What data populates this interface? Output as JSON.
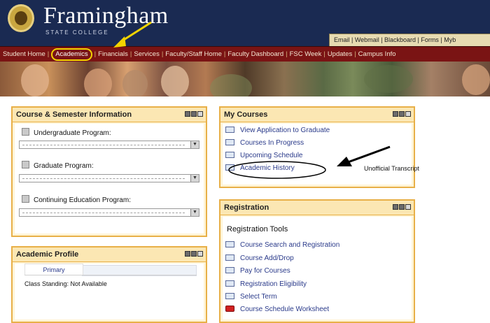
{
  "header": {
    "brand": "Framingham",
    "brand_sub": "STATE COLLEGE",
    "utility_links": "Email | Webmail | Blackboard | Forms | Myb"
  },
  "nav": {
    "items": [
      "Student Home",
      "Academics",
      "Financials",
      "Services",
      "Faculty/Staff Home",
      "Faculty Dashboard",
      "FSC Week",
      "Updates",
      "Campus Info"
    ]
  },
  "panels": {
    "course_semester": {
      "title": "Course & Semester Information",
      "programs": [
        "Undergraduate Program:",
        "Graduate Program:",
        "Continuing Education Program:"
      ]
    },
    "academic_profile": {
      "title": "Academic Profile",
      "tab": "Primary",
      "line": "Class Standing: Not Available"
    },
    "my_courses": {
      "title": "My Courses",
      "links": [
        "View Application to Graduate",
        "Courses In Progress",
        "Upcoming Schedule",
        "Academic History"
      ]
    },
    "registration": {
      "title": "Registration",
      "subtitle": "Registration Tools",
      "links": [
        "Course Search and Registration",
        "Course Add/Drop",
        "Pay for Courses",
        "Registration Eligibility",
        "Select Term",
        "Course Schedule Worksheet"
      ]
    }
  },
  "annotation": {
    "text": "Unofficial Transcript"
  },
  "colors": {
    "header_bg": "#1a2a52",
    "nav_bg": "#7a1414",
    "panel_border": "#e8b048",
    "highlight": "#f2d400"
  }
}
